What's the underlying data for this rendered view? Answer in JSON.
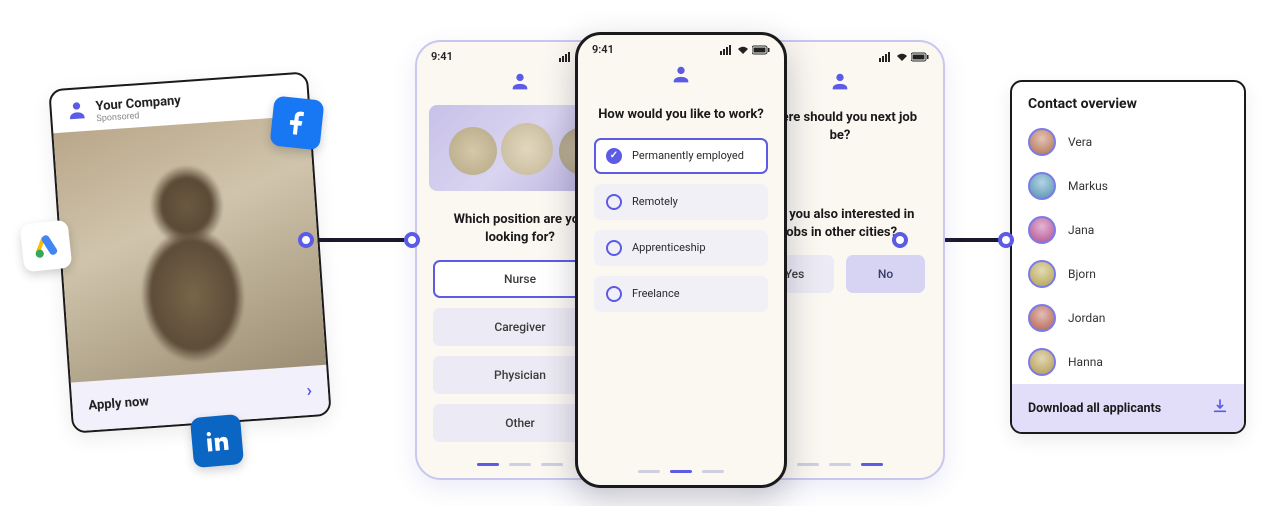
{
  "social_card": {
    "company": "Your Company",
    "sponsored": "Sponsored",
    "cta": "Apply now"
  },
  "status_time": "9:41",
  "phone_left": {
    "question": "Which position are you looking for?",
    "options": [
      "Nurse",
      "Caregiver",
      "Physician",
      "Other"
    ]
  },
  "phone_center": {
    "question": "How would you like to work?",
    "options": [
      "Permanently employed",
      "Remotely",
      "Apprenticeship",
      "Freelance"
    ]
  },
  "phone_right": {
    "title_partial": "Where should you next job be?",
    "question_partial": "Are you also interested in jobs in other cities?",
    "yes": "Yes",
    "no": "No"
  },
  "contacts": {
    "title": "Contact overview",
    "people": [
      "Vera",
      "Markus",
      "Jana",
      "Bjorn",
      "Jordan",
      "Hanna"
    ],
    "download": "Download all applicants"
  },
  "avatar_hue": [
    20,
    200,
    320,
    50,
    10,
    45
  ]
}
